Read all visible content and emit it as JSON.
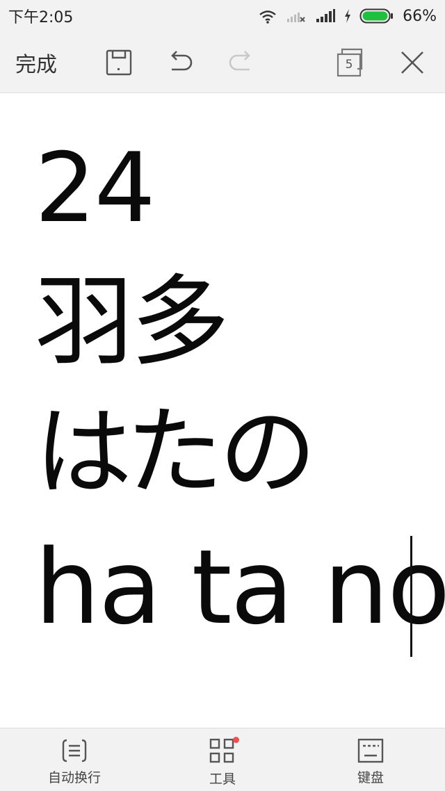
{
  "status_bar": {
    "time": "下午2:05",
    "battery_percent": "66%",
    "battery_level": 0.66,
    "battery_color": "#1fbf3f"
  },
  "toolbar": {
    "done_label": "完成",
    "page_count": "5",
    "redo_enabled": false
  },
  "editor": {
    "lines": [
      "24",
      "羽多",
      "はたの",
      "ha ta no"
    ]
  },
  "bottom_bar": {
    "items": [
      {
        "label": "自动换行",
        "icon": "text-wrap-icon"
      },
      {
        "label": "工具",
        "icon": "tools-grid-icon",
        "has_dot": true
      },
      {
        "label": "键盘",
        "icon": "keyboard-icon"
      }
    ],
    "notification_dot_color": "#f05050"
  }
}
